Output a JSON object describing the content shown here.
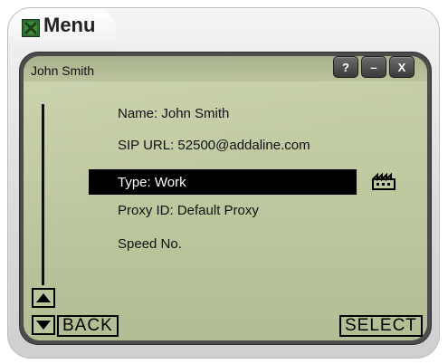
{
  "window": {
    "title": "Menu"
  },
  "header": {
    "contact_name": "John Smith"
  },
  "controls": {
    "help": "?",
    "minimize": "–",
    "close": "X"
  },
  "menu": {
    "items": [
      {
        "label": "Name: John Smith"
      },
      {
        "label": "SIP URL: 52500@addaline.com"
      },
      {
        "label": "Type: Work",
        "selected": true,
        "icon": "factory-icon"
      },
      {
        "label": "Proxy ID: Default Proxy"
      },
      {
        "label": "Speed No."
      }
    ]
  },
  "footer": {
    "back_label": "BACK",
    "select_label": "SELECT"
  },
  "colors": {
    "lcd_bg": "#bcc69c",
    "selection_bg": "#000000",
    "frame": "#4c4c4c"
  }
}
